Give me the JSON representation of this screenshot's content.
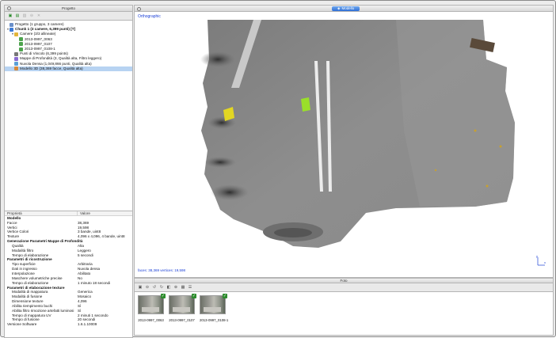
{
  "workspace": {
    "title": "Progetto",
    "toolbar_icons": [
      "add-chunk-icon",
      "add-photos-icon",
      "import-icon",
      "remove-icon",
      "close-icon"
    ],
    "tree": [
      {
        "label": "Progetto (1 gruppo, 3 camere)",
        "level": 0,
        "icon": "project-icon",
        "twisty": "",
        "bold": false
      },
      {
        "label": "Chunk 1 (3 camere, 6,399 punti) [T]",
        "level": 0,
        "icon": "chunk-icon",
        "twisty": "▾",
        "bold": true
      },
      {
        "label": "Camere (3/3 allineate)",
        "level": 1,
        "icon": "cameras-folder-icon",
        "twisty": "▾",
        "bold": false
      },
      {
        "label": "2013-0997_0063",
        "level": 2,
        "icon": "camera-icon",
        "twisty": "",
        "bold": false
      },
      {
        "label": "2013-0997_0107",
        "level": 2,
        "icon": "camera-icon",
        "twisty": "",
        "bold": false
      },
      {
        "label": "2013-0997_0108-1",
        "level": 2,
        "icon": "camera-icon",
        "twisty": "",
        "bold": false
      },
      {
        "label": "Punti di Vincolo (6,399 points)",
        "level": 1,
        "icon": "tie-points-icon",
        "twisty": "",
        "bold": false
      },
      {
        "label": "Mappe di Profondità (3, Qualità alta, Filtro leggero)",
        "level": 1,
        "icon": "depth-maps-icon",
        "twisty": "",
        "bold": false
      },
      {
        "label": "Nuvola Densa (1,049,866 punti, Qualità alta)",
        "level": 1,
        "icon": "dense-cloud-icon",
        "twisty": "",
        "bold": false
      },
      {
        "label": "Modello 3D (38,369 facce, Qualità alta)",
        "level": 1,
        "icon": "model-3d-icon",
        "twisty": "",
        "bold": false,
        "selected": true
      }
    ]
  },
  "properties": {
    "headers": [
      "Proprietà",
      "Valore"
    ],
    "rows": [
      {
        "k": "Modello",
        "v": "",
        "type": "sec"
      },
      {
        "k": "Facce",
        "v": "38,369",
        "type": "item"
      },
      {
        "k": "Vertici",
        "v": "19,598",
        "type": "item"
      },
      {
        "k": "Vertice Colori",
        "v": "3 bande, uint8",
        "type": "item"
      },
      {
        "k": "Texture",
        "v": "4,096 x 4,096, 4 bande, uint8",
        "type": "item"
      },
      {
        "k": "Generazione Parametri Mappe di Profondità",
        "v": "",
        "type": "sec"
      },
      {
        "k": "Qualità",
        "v": "Alta",
        "type": "sub"
      },
      {
        "k": "Modalità filtro",
        "v": "Leggero",
        "type": "sub"
      },
      {
        "k": "Tempo di elaborazione",
        "v": "5 secondi",
        "type": "sub"
      },
      {
        "k": "Parametri di ricostruzione",
        "v": "",
        "type": "sec"
      },
      {
        "k": "Tipo superficie",
        "v": "Arbitraria",
        "type": "sub"
      },
      {
        "k": "Dati in ingresso",
        "v": "Nuvola densa",
        "type": "sub"
      },
      {
        "k": "Interpolazione",
        "v": "Abilitato",
        "type": "sub"
      },
      {
        "k": "Maschere volumetriche precise",
        "v": "No",
        "type": "sub"
      },
      {
        "k": "Tempo di elaborazione",
        "v": "1 minuto 18 secondi",
        "type": "sub"
      },
      {
        "k": "Parametri di elaborazione texture",
        "v": "",
        "type": "sec"
      },
      {
        "k": "Modalità di mappatura",
        "v": "Generica",
        "type": "sub"
      },
      {
        "k": "Modalità di fusione",
        "v": "Mosaico",
        "type": "sub"
      },
      {
        "k": "Dimensione texture",
        "v": "4,096",
        "type": "sub"
      },
      {
        "k": "Abilita riempimento buchi",
        "v": "Sì",
        "type": "sub"
      },
      {
        "k": "Abilita filtro rimozione artefatti luminosi",
        "v": "Sì",
        "type": "sub"
      },
      {
        "k": "Tempo di mappatura UV",
        "v": "2 minuti 1 secondo",
        "type": "sub"
      },
      {
        "k": "Tempo di fusione",
        "v": "20 secondi",
        "type": "sub"
      },
      {
        "k": "Versione Software",
        "v": "1.6.1.10009",
        "type": "item"
      }
    ]
  },
  "model_view": {
    "tab_label": "Modello",
    "projection": "Orthographic",
    "stats": "faces: 38,369 vertices: 19,598",
    "axis_labels": {
      "x": "x",
      "y": "y"
    }
  },
  "photos": {
    "title": "Foto",
    "toolbar_icons": [
      "add-photo-icon",
      "remove-photo-icon",
      "rotate-left-icon",
      "rotate-right-icon",
      "mask-icon",
      "zoom-icon",
      "grid-icon",
      "details-icon"
    ],
    "items": [
      {
        "caption": "2013-0997_0063"
      },
      {
        "caption": "2013-0997_0107"
      },
      {
        "caption": "2013-0997_0108-1"
      }
    ]
  },
  "colors": {
    "accent": "#2f6fd6",
    "selection": "#b7d3f2",
    "overlay_text": "#1a3fd6"
  }
}
